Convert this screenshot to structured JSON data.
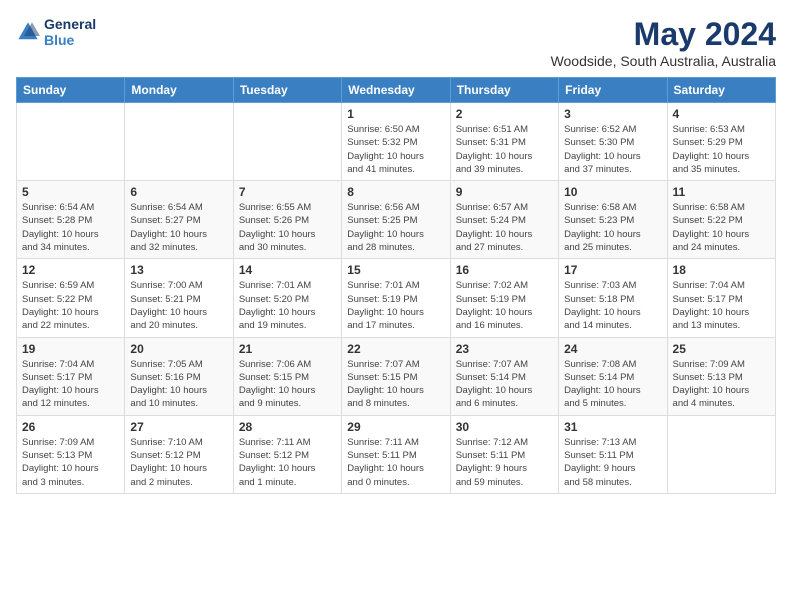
{
  "header": {
    "logo_line1": "General",
    "logo_line2": "Blue",
    "month": "May 2024",
    "location": "Woodside, South Australia, Australia"
  },
  "days_of_week": [
    "Sunday",
    "Monday",
    "Tuesday",
    "Wednesday",
    "Thursday",
    "Friday",
    "Saturday"
  ],
  "weeks": [
    [
      {
        "day": "",
        "info": ""
      },
      {
        "day": "",
        "info": ""
      },
      {
        "day": "",
        "info": ""
      },
      {
        "day": "1",
        "info": "Sunrise: 6:50 AM\nSunset: 5:32 PM\nDaylight: 10 hours\nand 41 minutes."
      },
      {
        "day": "2",
        "info": "Sunrise: 6:51 AM\nSunset: 5:31 PM\nDaylight: 10 hours\nand 39 minutes."
      },
      {
        "day": "3",
        "info": "Sunrise: 6:52 AM\nSunset: 5:30 PM\nDaylight: 10 hours\nand 37 minutes."
      },
      {
        "day": "4",
        "info": "Sunrise: 6:53 AM\nSunset: 5:29 PM\nDaylight: 10 hours\nand 35 minutes."
      }
    ],
    [
      {
        "day": "5",
        "info": "Sunrise: 6:54 AM\nSunset: 5:28 PM\nDaylight: 10 hours\nand 34 minutes."
      },
      {
        "day": "6",
        "info": "Sunrise: 6:54 AM\nSunset: 5:27 PM\nDaylight: 10 hours\nand 32 minutes."
      },
      {
        "day": "7",
        "info": "Sunrise: 6:55 AM\nSunset: 5:26 PM\nDaylight: 10 hours\nand 30 minutes."
      },
      {
        "day": "8",
        "info": "Sunrise: 6:56 AM\nSunset: 5:25 PM\nDaylight: 10 hours\nand 28 minutes."
      },
      {
        "day": "9",
        "info": "Sunrise: 6:57 AM\nSunset: 5:24 PM\nDaylight: 10 hours\nand 27 minutes."
      },
      {
        "day": "10",
        "info": "Sunrise: 6:58 AM\nSunset: 5:23 PM\nDaylight: 10 hours\nand 25 minutes."
      },
      {
        "day": "11",
        "info": "Sunrise: 6:58 AM\nSunset: 5:22 PM\nDaylight: 10 hours\nand 24 minutes."
      }
    ],
    [
      {
        "day": "12",
        "info": "Sunrise: 6:59 AM\nSunset: 5:22 PM\nDaylight: 10 hours\nand 22 minutes."
      },
      {
        "day": "13",
        "info": "Sunrise: 7:00 AM\nSunset: 5:21 PM\nDaylight: 10 hours\nand 20 minutes."
      },
      {
        "day": "14",
        "info": "Sunrise: 7:01 AM\nSunset: 5:20 PM\nDaylight: 10 hours\nand 19 minutes."
      },
      {
        "day": "15",
        "info": "Sunrise: 7:01 AM\nSunset: 5:19 PM\nDaylight: 10 hours\nand 17 minutes."
      },
      {
        "day": "16",
        "info": "Sunrise: 7:02 AM\nSunset: 5:19 PM\nDaylight: 10 hours\nand 16 minutes."
      },
      {
        "day": "17",
        "info": "Sunrise: 7:03 AM\nSunset: 5:18 PM\nDaylight: 10 hours\nand 14 minutes."
      },
      {
        "day": "18",
        "info": "Sunrise: 7:04 AM\nSunset: 5:17 PM\nDaylight: 10 hours\nand 13 minutes."
      }
    ],
    [
      {
        "day": "19",
        "info": "Sunrise: 7:04 AM\nSunset: 5:17 PM\nDaylight: 10 hours\nand 12 minutes."
      },
      {
        "day": "20",
        "info": "Sunrise: 7:05 AM\nSunset: 5:16 PM\nDaylight: 10 hours\nand 10 minutes."
      },
      {
        "day": "21",
        "info": "Sunrise: 7:06 AM\nSunset: 5:15 PM\nDaylight: 10 hours\nand 9 minutes."
      },
      {
        "day": "22",
        "info": "Sunrise: 7:07 AM\nSunset: 5:15 PM\nDaylight: 10 hours\nand 8 minutes."
      },
      {
        "day": "23",
        "info": "Sunrise: 7:07 AM\nSunset: 5:14 PM\nDaylight: 10 hours\nand 6 minutes."
      },
      {
        "day": "24",
        "info": "Sunrise: 7:08 AM\nSunset: 5:14 PM\nDaylight: 10 hours\nand 5 minutes."
      },
      {
        "day": "25",
        "info": "Sunrise: 7:09 AM\nSunset: 5:13 PM\nDaylight: 10 hours\nand 4 minutes."
      }
    ],
    [
      {
        "day": "26",
        "info": "Sunrise: 7:09 AM\nSunset: 5:13 PM\nDaylight: 10 hours\nand 3 minutes."
      },
      {
        "day": "27",
        "info": "Sunrise: 7:10 AM\nSunset: 5:12 PM\nDaylight: 10 hours\nand 2 minutes."
      },
      {
        "day": "28",
        "info": "Sunrise: 7:11 AM\nSunset: 5:12 PM\nDaylight: 10 hours\nand 1 minute."
      },
      {
        "day": "29",
        "info": "Sunrise: 7:11 AM\nSunset: 5:11 PM\nDaylight: 10 hours\nand 0 minutes."
      },
      {
        "day": "30",
        "info": "Sunrise: 7:12 AM\nSunset: 5:11 PM\nDaylight: 9 hours\nand 59 minutes."
      },
      {
        "day": "31",
        "info": "Sunrise: 7:13 AM\nSunset: 5:11 PM\nDaylight: 9 hours\nand 58 minutes."
      },
      {
        "day": "",
        "info": ""
      }
    ]
  ]
}
